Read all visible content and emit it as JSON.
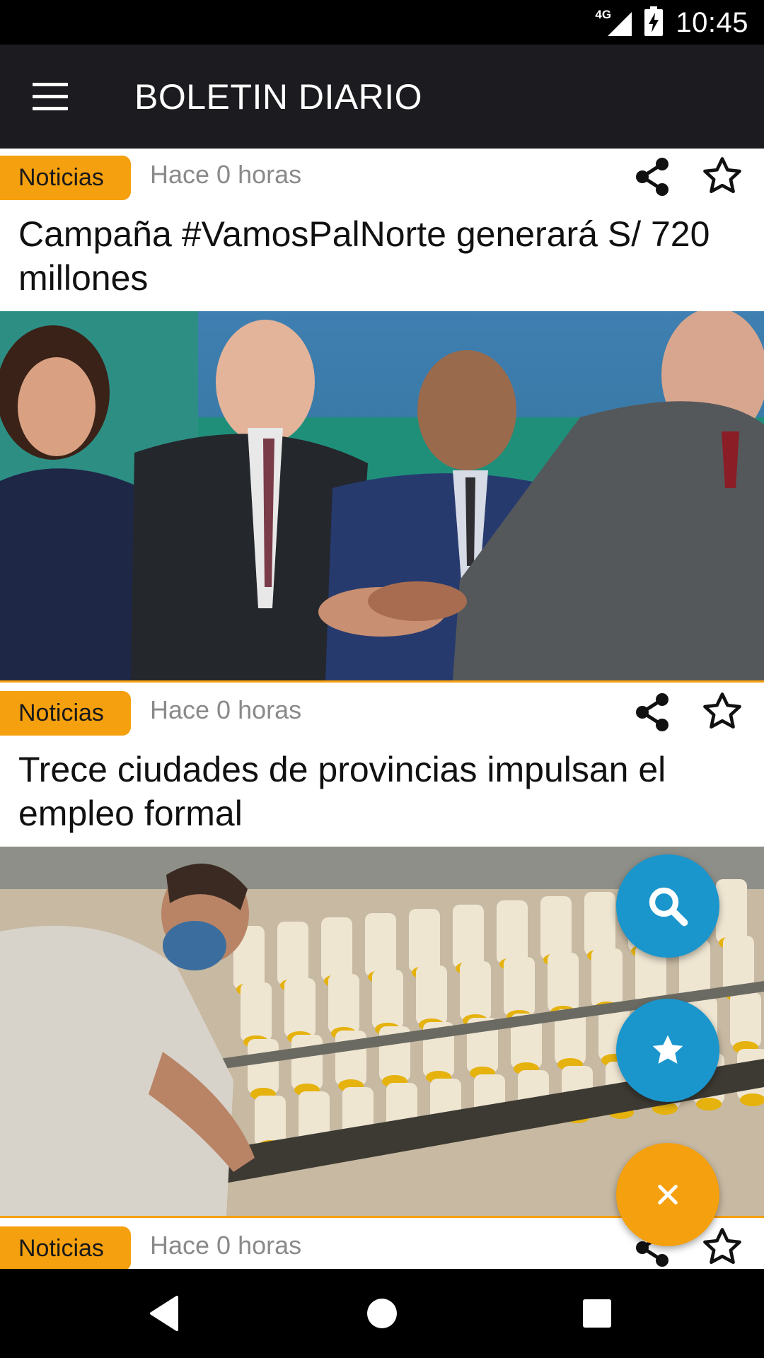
{
  "status_bar": {
    "time": "10:45",
    "network": "4G"
  },
  "app_bar": {
    "title": "BOLETIN DIARIO",
    "menu_icon": "hamburger-menu-icon"
  },
  "articles": [
    {
      "category": "Noticias",
      "time_ago": "Hace 0 horas",
      "title": "Campaña #VamosPalNorte generará S/ 720 millones",
      "image": "group-handshake-photo"
    },
    {
      "category": "Noticias",
      "time_ago": "Hace 0 horas",
      "title": "Trece ciudades de provincias impulsan el empleo formal",
      "image": "textile-factory-worker-photo"
    },
    {
      "category": "Noticias",
      "time_ago": "Hace 0 horas",
      "title": "",
      "image": ""
    }
  ],
  "fabs": [
    {
      "icon": "search-icon",
      "color": "#1a96cc"
    },
    {
      "icon": "star-icon",
      "color": "#1a96cc"
    },
    {
      "icon": "close-icon",
      "color": "#f5a00e"
    }
  ],
  "nav_bar": {
    "back": "back-triangle-icon",
    "home": "home-circle-icon",
    "recents": "recents-square-icon"
  },
  "colors": {
    "accent": "#f5a00e",
    "app_bar": "#1c1b20",
    "fab_blue": "#1a96cc"
  }
}
